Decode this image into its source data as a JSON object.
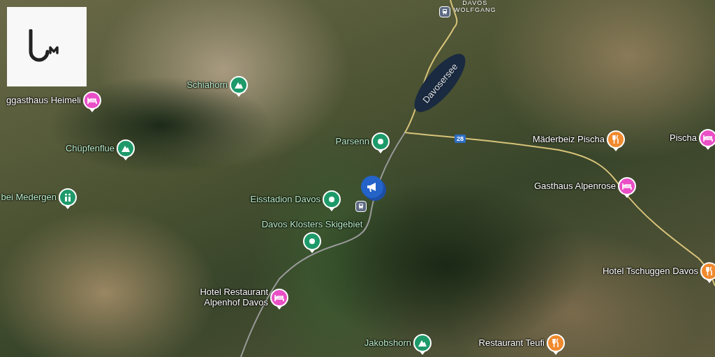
{
  "map": {
    "area_label": [
      "DAVOS",
      "WOLFGANG"
    ],
    "lake_label": "Davosersee",
    "road_shield": "28",
    "places": [
      {
        "label": "ggasthaus Heimeli",
        "kind": "hotel",
        "color": "#ea4fc6"
      },
      {
        "label": "Schiahorn",
        "kind": "peak",
        "color": "#1e9a6a"
      },
      {
        "label": "Chüpfenflue",
        "kind": "peak",
        "color": "#1e9a6a"
      },
      {
        "label": "bei Medergen",
        "kind": "hut",
        "color": "#1e9a6a"
      },
      {
        "label": "Parsenn",
        "kind": "poi",
        "color": "#1e9a6a"
      },
      {
        "label": "Eisstadion Davos",
        "kind": "poi",
        "color": "#1e9a6a"
      },
      {
        "label": "Davos Klosters Skigebiet",
        "kind": "poi",
        "color": "#1e9a6a"
      },
      {
        "label": "Hotel Restaurant Alpenhof Davos",
        "kind": "hotel",
        "color": "#ea4fc6"
      },
      {
        "label": "Jakobshorn",
        "kind": "peak",
        "color": "#1e9a6a"
      },
      {
        "label": "Restaurant Teufi",
        "kind": "restaurant",
        "color": "#f08a2e"
      },
      {
        "label": "Mäderbeiz Pischa",
        "kind": "restaurant",
        "color": "#f08a2e"
      },
      {
        "label": "Pischa",
        "kind": "hotel",
        "color": "#ea4fc6"
      },
      {
        "label": "Gasthaus Alpenrose",
        "kind": "hotel",
        "color": "#ea4fc6"
      },
      {
        "label": "Hotel Tschuggen Davos",
        "kind": "restaurant",
        "color": "#f08a2e"
      }
    ]
  }
}
